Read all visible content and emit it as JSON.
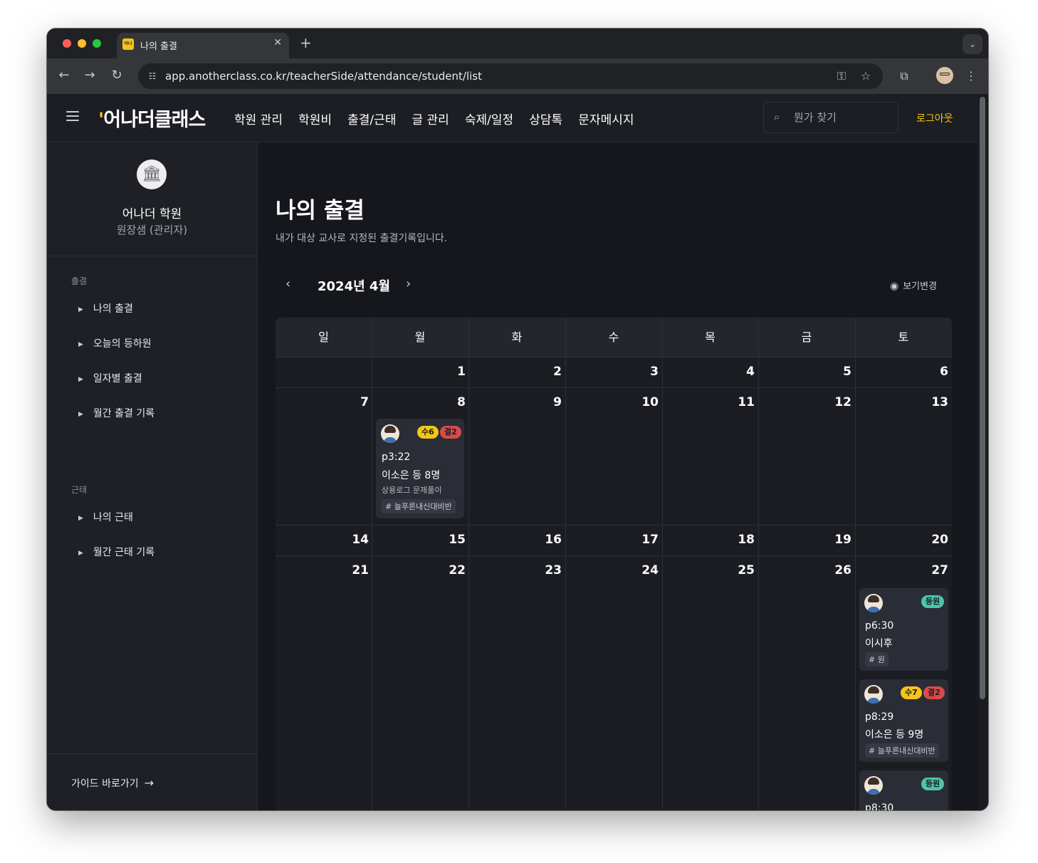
{
  "browser": {
    "tab_title": "나의 출결",
    "favicon_text": "어나",
    "url": "app.anotherclass.co.kr/teacherSide/attendance/student/list"
  },
  "header": {
    "logo": "어나더클래스",
    "nav": [
      "학원 관리",
      "학원비",
      "출결/근태",
      "글 관리",
      "숙제/일정",
      "상담톡",
      "문자메시지"
    ],
    "search_placeholder": "뭔가 찾기",
    "logout_label": "로그아웃"
  },
  "sidebar": {
    "org_name": "어나더 학원",
    "org_role": "원장샘 (관리자)",
    "sections": [
      {
        "title": "출결",
        "items": [
          "나의 출결",
          "오늘의 등하원",
          "일자별 출결",
          "월간 출결 기록"
        ]
      },
      {
        "title": "근태",
        "items": [
          "나의 근태",
          "월간 근태 기록"
        ]
      }
    ],
    "guide_label": "가이드 바로가기"
  },
  "main": {
    "title": "나의 출결",
    "description": "내가 대상 교사로 지정된 출결기록입니다.",
    "month_label": "2024년 4월",
    "view_change_label": "보기변경"
  },
  "calendar": {
    "weekdays": [
      "일",
      "월",
      "화",
      "수",
      "목",
      "금",
      "토"
    ],
    "weeks": [
      [
        "",
        "1",
        "2",
        "3",
        "4",
        "5",
        "6"
      ],
      [
        "7",
        "8",
        "9",
        "10",
        "11",
        "12",
        "13"
      ],
      [
        "14",
        "15",
        "16",
        "17",
        "18",
        "19",
        "20"
      ],
      [
        "21",
        "22",
        "23",
        "24",
        "25",
        "26",
        "27"
      ]
    ],
    "events": {
      "apr8": [
        {
          "badges": [
            {
              "text": "수6",
              "color": "yellow"
            },
            {
              "text": "결2",
              "color": "red"
            }
          ],
          "time": "p3:22",
          "students": "이소은 등 8명",
          "desc": "상용로그 문제풀이",
          "tag": "# 늘푸른내신대비반"
        }
      ],
      "apr27": [
        {
          "badges": [
            {
              "text": "등원",
              "color": "green"
            }
          ],
          "time": "p6:30",
          "students": "이시후",
          "tag": "# 원"
        },
        {
          "badges": [
            {
              "text": "수7",
              "color": "yellow"
            },
            {
              "text": "결2",
              "color": "red"
            }
          ],
          "time": "p8:29",
          "students": "이소은 등 9명",
          "tag": "# 늘푸른내신대비반"
        },
        {
          "badges": [
            {
              "text": "등원",
              "color": "green"
            }
          ],
          "time": "p8:30"
        }
      ]
    }
  }
}
